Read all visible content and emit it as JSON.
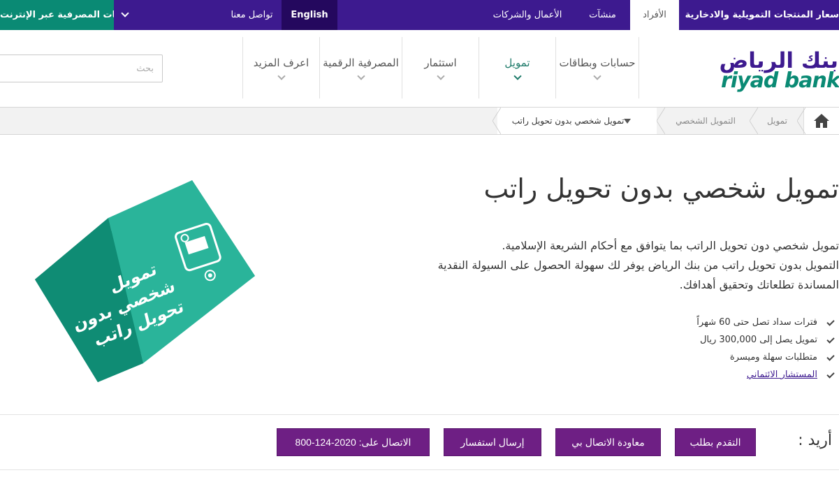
{
  "topbar": {
    "online_banking_label": "الخدمات المصرفية عبر الإنترنت",
    "contact_label": "تواصل معنا",
    "language_label": "English",
    "business_label": "الأعمال والشركات",
    "establishments_label": "منشآت",
    "individuals_label": "الأفراد",
    "prices_label": "أسعار المنتجات التمويلية والادخارية"
  },
  "search": {
    "placeholder": "بحث"
  },
  "nav": {
    "more": "اعرف المزيد",
    "digital": "المصرفية الرقمية",
    "invest": "استثمار",
    "finance": "تمويل",
    "accounts": "حسابات وبطاقات"
  },
  "logo": {
    "arabic": "بنك الرياض",
    "english": "riyad bank"
  },
  "breadcrumb": {
    "finance": "تمويل",
    "personal_finance": "التمويل الشخصي",
    "current": "تمويل شخصي بدون تحويل راتب"
  },
  "main": {
    "title": "تمويل شخصي بدون تحويل راتب",
    "desc_line1": "تمويل شخصي دون تحويل الراتب بما يتوافق مع أحكام الشريعة الإسلامية.",
    "desc_line2": "التمويل بدون تحويل راتب من بنك الرياض يوفر لك سهولة الحصول على السيولة النقدية",
    "desc_line3": "المساندة تطلعاتك وتحقيق أهدافك.",
    "features": [
      "فترات سداد تصل حتى 60 شهراً",
      "تمويل يصل إلى 300,000 ريال",
      "متطلبات سهلة وميسرة"
    ],
    "advisor_link": "المستشار الائتماني"
  },
  "cube": {
    "line1": "تمويل",
    "line2": "شخصي بدون",
    "line3": "تحويل راتب"
  },
  "actions": {
    "want_label": "أريد :",
    "apply": "التقدم بطلب",
    "callback": "معاودة الاتصال بي",
    "inquiry": "إرسال استفسار",
    "call": "الاتصال على: 2020-124-800"
  },
  "colors": {
    "purple": "#3d1a8f",
    "green": "#0a8a74",
    "button": "#6e1f84"
  }
}
